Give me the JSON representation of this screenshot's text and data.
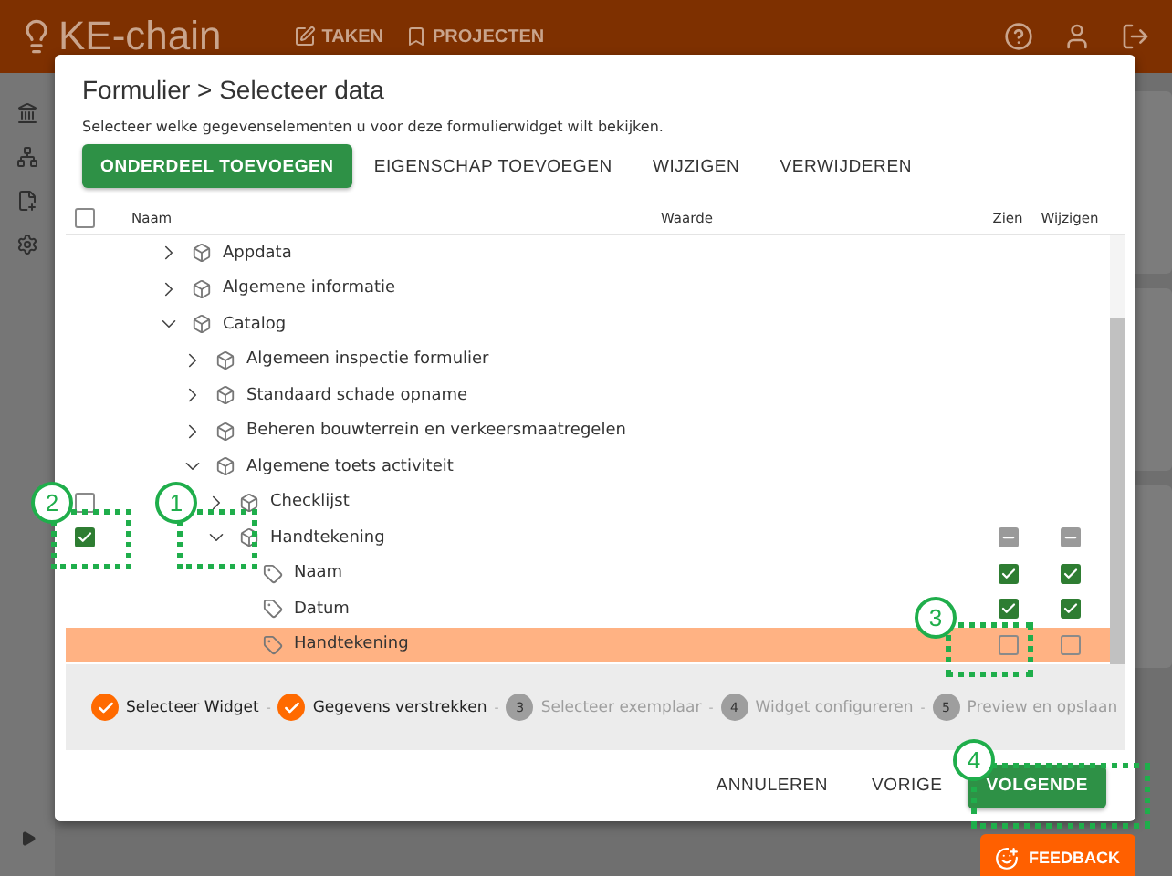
{
  "app": {
    "logo": "KE-chain",
    "nav": [
      "TAKEN",
      "PROJECTEN"
    ]
  },
  "dialog": {
    "title": "Formulier > Selecteer data",
    "description": "Selecteer welke gegevenselementen u voor deze formulierwidget wilt bekijken.",
    "actions": [
      {
        "label": "ONDERDEEL TOEVOEGEN",
        "kind": "primary"
      },
      {
        "label": "EIGENSCHAP TOEVOEGEN",
        "kind": "text"
      },
      {
        "label": "WIJZIGEN",
        "kind": "text"
      },
      {
        "label": "VERWIJDEREN",
        "kind": "text"
      }
    ],
    "columns": {
      "select_all_checked": false,
      "name": "Naam",
      "value": "Waarde",
      "view": "Zien",
      "edit": "Wijzigen"
    },
    "tree": [
      {
        "label": "Appdata",
        "kind": "part",
        "expanded": false
      },
      {
        "label": "Algemene informatie",
        "kind": "part",
        "expanded": false
      },
      {
        "label": "Catalog",
        "kind": "part",
        "expanded": true,
        "children": [
          {
            "label": "Algemeen inspectie formulier",
            "kind": "part",
            "expanded": false
          },
          {
            "label": "Standaard schade opname",
            "kind": "part",
            "expanded": false
          },
          {
            "label": "Beheren bouwterrein en verkeersmaatregelen",
            "kind": "part",
            "expanded": false
          },
          {
            "label": "Algemene toets activiteit",
            "kind": "part",
            "expanded": true,
            "children": [
              {
                "label": "Checklijst",
                "kind": "part",
                "expanded": false,
                "checked": false
              },
              {
                "label": "Handtekening",
                "kind": "part",
                "expanded": true,
                "checked": true,
                "view_mixed": true,
                "edit_mixed": true,
                "children": [
                  {
                    "label": "Naam",
                    "kind": "property",
                    "view_checked": true,
                    "edit_checked": true,
                    "highlighted": false
                  },
                  {
                    "label": "Datum",
                    "kind": "property",
                    "view_checked": true,
                    "edit_checked": true,
                    "highlighted": false
                  },
                  {
                    "label": "Handtekening",
                    "kind": "property",
                    "view_checked": false,
                    "edit_checked": false,
                    "highlighted": true
                  }
                ]
              }
            ]
          }
        ]
      }
    ],
    "steps": [
      {
        "label": "Selecteer Widget",
        "done": true
      },
      {
        "separator": "-",
        "label": "Gegevens verstrekken",
        "done": true
      },
      {
        "separator": "-",
        "label": "Selecteer exemplaar",
        "done": false,
        "number": "3"
      },
      {
        "separator": "-",
        "label": "Widget configureren",
        "done": false,
        "number": "4"
      },
      {
        "separator": "-",
        "label": "Preview en opslaan",
        "done": false,
        "number": "5"
      }
    ],
    "footer": [
      {
        "label": "ANNULEREN",
        "kind": "text"
      },
      {
        "label": "VORIGE",
        "kind": "text"
      },
      {
        "label": "VOLGENDE",
        "kind": "primary"
      }
    ]
  },
  "feedback": {
    "label": "FEEDBACK"
  },
  "annotations": [
    {
      "label": "1"
    },
    {
      "label": "2"
    },
    {
      "label": "3"
    },
    {
      "label": "4"
    }
  ]
}
